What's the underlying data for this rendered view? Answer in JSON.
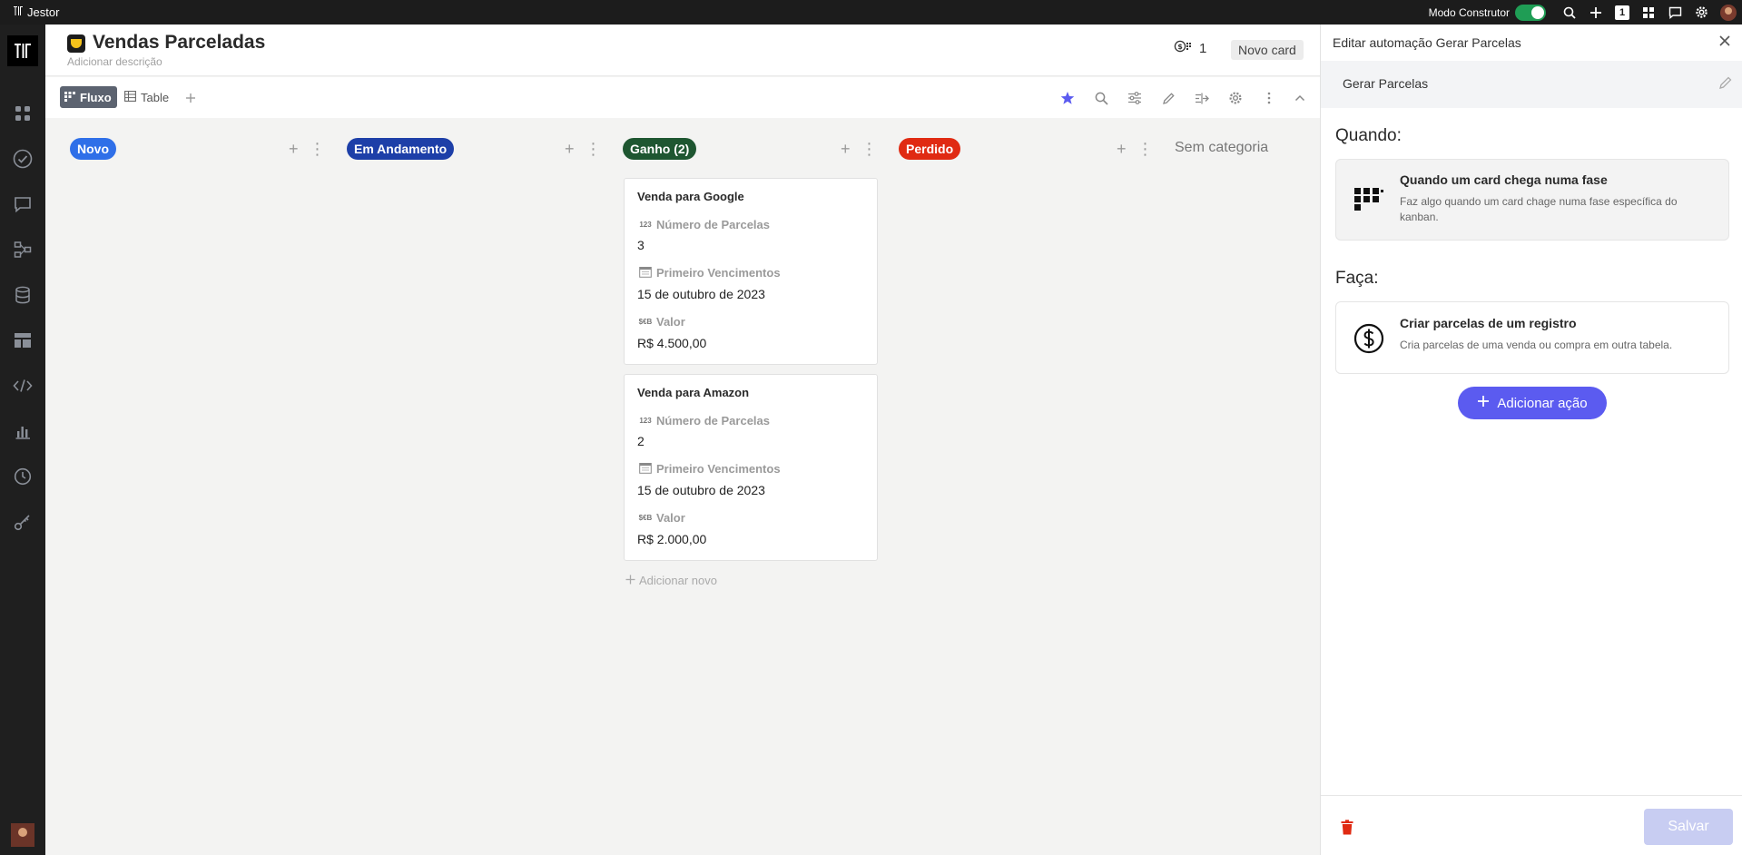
{
  "topbar": {
    "brand": "Jestor",
    "builder_mode_label": "Modo Construtor",
    "notification_count": "1"
  },
  "header": {
    "title": "Vendas Parceladas",
    "description_placeholder": "Adicionar descrição",
    "count": "1",
    "new_card_label": "Novo card"
  },
  "views": [
    {
      "label": "Fluxo",
      "active": true
    },
    {
      "label": "Table",
      "active": false
    }
  ],
  "board": {
    "columns": [
      {
        "label": "Novo",
        "color": "#2f6fe8"
      },
      {
        "label": "Em Andamento",
        "color": "#1d3fa8"
      },
      {
        "label": "Ganho (2)",
        "color": "#1e5631"
      },
      {
        "label": "Perdido",
        "color": "#e02a12"
      }
    ],
    "uncategorized_label": "Sem categoria",
    "add_new_label": "Adicionar novo",
    "cards": [
      {
        "title": "Venda para Google",
        "fields": [
          {
            "icon": "123",
            "label": "Número de Parcelas",
            "value": "3"
          },
          {
            "icon": "calendar",
            "label": "Primeiro Vencimentos",
            "value": "15 de outubro de 2023"
          },
          {
            "icon": "$€B",
            "label": "Valor",
            "value": "R$ 4.500,00"
          }
        ]
      },
      {
        "title": "Venda para Amazon",
        "fields": [
          {
            "icon": "123",
            "label": "Número de Parcelas",
            "value": "2"
          },
          {
            "icon": "calendar",
            "label": "Primeiro Vencimentos",
            "value": "15 de outubro de 2023"
          },
          {
            "icon": "$€B",
            "label": "Valor",
            "value": "R$ 2.000,00"
          }
        ]
      }
    ]
  },
  "panel": {
    "title": "Editar automação Gerar Parcelas",
    "automation_name": "Gerar Parcelas",
    "when_label": "Quando:",
    "trigger": {
      "title": "Quando um card chega numa fase",
      "description": "Faz algo quando um card chage numa fase específica do kanban."
    },
    "do_label": "Faça:",
    "action": {
      "title": "Criar parcelas de um registro",
      "description": "Cria parcelas de uma venda ou compra em outra tabela."
    },
    "add_action_label": "Adicionar ação",
    "save_label": "Salvar"
  },
  "colors": {
    "accent": "#5b5bf0",
    "toggle_on": "#1f9d55",
    "danger": "#e02a12"
  }
}
